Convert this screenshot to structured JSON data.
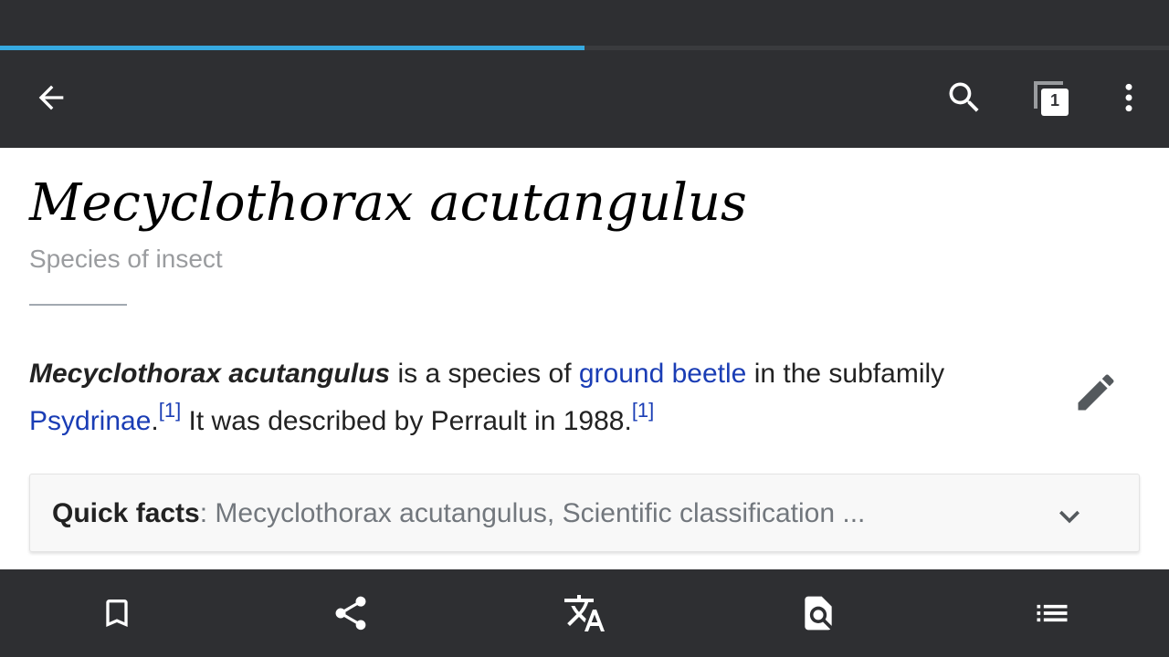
{
  "progress": {
    "fraction": 0.5,
    "color": "#36a9e0"
  },
  "toolbar": {
    "back_icon": "arrow-left-icon",
    "search_icon": "search-icon",
    "tabs_icon": "tabs-icon",
    "tab_count": "1",
    "overflow_icon": "more-vertical-icon"
  },
  "article": {
    "title": "Mecyclothorax acutangulus",
    "description": "Species of insect",
    "lead": {
      "subject": "Mecyclothorax acutangulus",
      "text1": " is a species of ",
      "link1": "ground beetle",
      "text2": " in the subfamily ",
      "link2": "Psydrinae",
      "text3": ".",
      "ref1": "[1]",
      "text4": " It was described by Perrault in 1988.",
      "ref2": "[1]"
    },
    "edit_icon": "pencil-icon"
  },
  "quick_facts": {
    "label": "Quick facts",
    "separator": ": ",
    "summary": "Mecyclothorax acutangulus, Scientific classification ...",
    "chevron_icon": "chevron-down-icon"
  },
  "bottom_bar": {
    "items": [
      {
        "icon": "bookmark-icon"
      },
      {
        "icon": "share-icon"
      },
      {
        "icon": "translate-icon"
      },
      {
        "icon": "find-in-page-icon"
      },
      {
        "icon": "table-of-contents-icon"
      }
    ]
  },
  "colors": {
    "chrome": "#2e2f32",
    "link": "#1a3db5",
    "description": "#9a9c9f",
    "quick_facts_bg": "#f8f8f8"
  }
}
